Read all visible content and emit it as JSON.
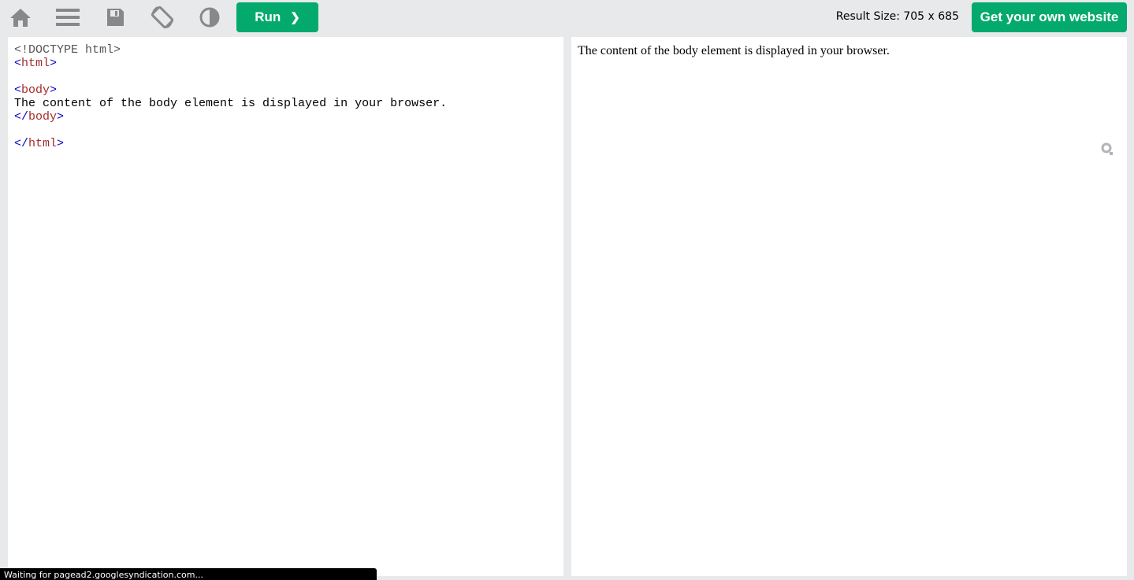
{
  "toolbar": {
    "icons": [
      "home-icon",
      "menu-icon",
      "save-icon",
      "rotate-icon",
      "theme-contrast-icon"
    ],
    "run_label": "Run",
    "run_chevron": "❯",
    "result_size_label": "Result Size: 705 x 685",
    "get_website_label": "Get your own website"
  },
  "editor": {
    "lines": [
      {
        "bracket_open": "<",
        "tag": "!DOCTYPE html",
        "bracket_close": ">",
        "doctype": true
      },
      {
        "bracket_open": "<",
        "tag": "html",
        "bracket_close": ">"
      },
      {
        "text": ""
      },
      {
        "bracket_open": "<",
        "tag": "body",
        "bracket_close": ">"
      },
      {
        "text": "The content of the body element is displayed in your browser."
      },
      {
        "bracket_open": "</",
        "tag": "body",
        "bracket_close": ">"
      },
      {
        "text": ""
      },
      {
        "bracket_open": "</",
        "tag": "html",
        "bracket_close": ">"
      }
    ]
  },
  "result": {
    "text": "The content of the body element is displayed in your browser."
  },
  "status_bar": {
    "text": "Waiting for pagead2.googlesyndication.com..."
  },
  "colors": {
    "accent_green": "#04aa6d",
    "background": "#e7e9eb",
    "icon_gray": "#888888",
    "tag_color": "#a52a2a",
    "bracket_color": "#0000cd"
  }
}
